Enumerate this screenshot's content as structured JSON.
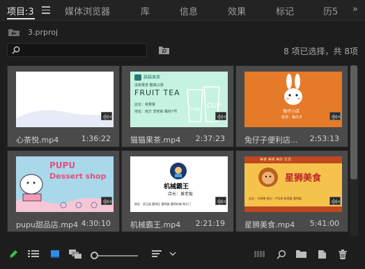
{
  "tabs": [
    {
      "label": "项目:3"
    },
    {
      "label": "媒体浏览器"
    },
    {
      "label": "库"
    },
    {
      "label": "信息"
    },
    {
      "label": "效果"
    },
    {
      "label": "标记"
    },
    {
      "label": "历5"
    }
  ],
  "breadcrumb": {
    "label": "3.prproj"
  },
  "search": {
    "value": "",
    "placeholder": ""
  },
  "status_text": "8 项已选择，共 8项",
  "items": [
    {
      "name": "心茶悦.mp4",
      "duration": "1:36:22"
    },
    {
      "name": "猫猫果茶.mp4",
      "duration": "2:37:23",
      "thumb": {
        "brand": "猫猫果茶",
        "sub": "FRUIT TEA",
        "line1": "清爽果茶 酷爽口感",
        "line2": "店长：林果果",
        "line3": "地址：南方 李老板 鹰桥7号"
      }
    },
    {
      "name": "兔仔子便利店...",
      "duration": "2:53:13",
      "thumb": {
        "title": "兔仔小店",
        "sub": "店长：兔仔子"
      }
    },
    {
      "name": "pupu甜品店.mp4",
      "duration": "4:30:10",
      "thumb": {
        "line1": "PUPU",
        "line2": "Dessert shop"
      }
    },
    {
      "name": "机械霸王.mp4",
      "duration": "2:21:19",
      "thumb": {
        "title": "机械霸王",
        "sub": "店长：黄老板",
        "addr": "地址：武汉县 鹿鸣区 鹿鸣路 鹿鸣机械 两大门"
      }
    },
    {
      "name": "星狮美食.mp4",
      "duration": "5:41:00",
      "thumb": {
        "title": "星狮美食",
        "top": "美食 美味 美好 生活",
        "bottom": "店长：马师傅 地址：卢沟桥 新荣路 鹿鸣路"
      }
    }
  ],
  "colors": {
    "accent_blue": "#2d8ceb",
    "green_pen": "#3fbf3f"
  }
}
